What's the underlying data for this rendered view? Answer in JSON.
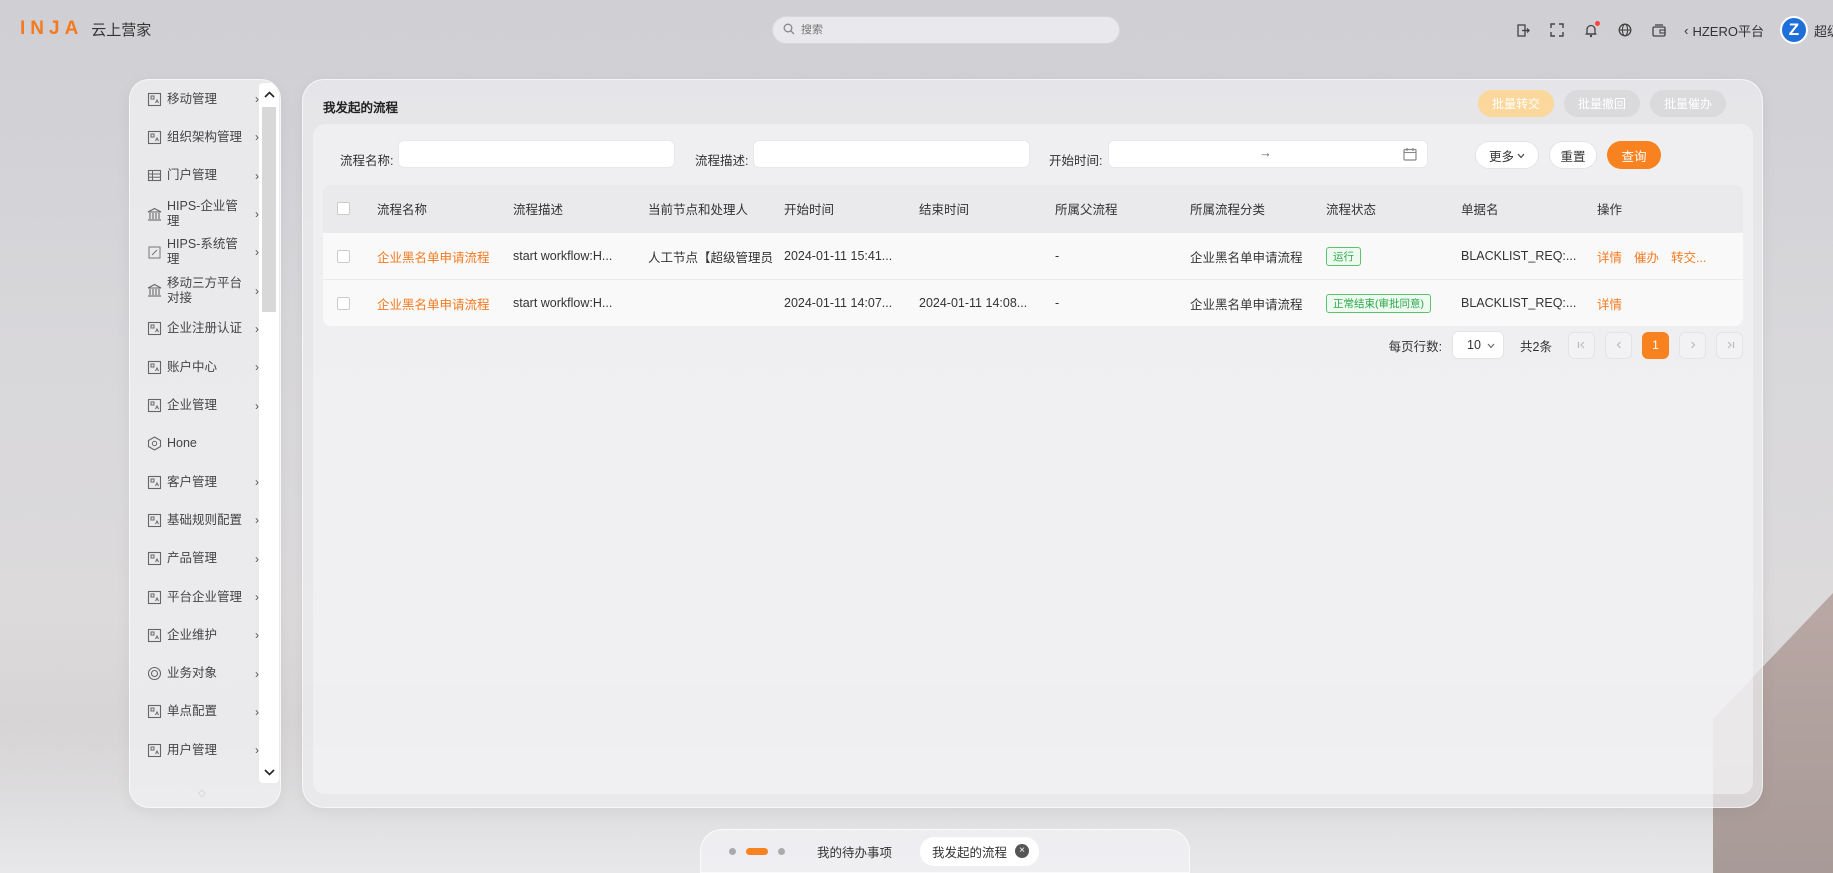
{
  "header": {
    "logo_mark": "INJA",
    "logo_text": "云上营家",
    "search_placeholder": "搜索",
    "platform": "HZERO平台",
    "user_name": "超级管",
    "avatar_letter": "Z",
    "icons": [
      "exit-icon",
      "fullscreen-icon",
      "bell-icon",
      "globe-icon",
      "wallet-icon"
    ]
  },
  "sidebar": {
    "items": [
      {
        "label": "移动管理",
        "icon": "module-icon",
        "arrow": true
      },
      {
        "label": "组织架构管理",
        "icon": "module-icon",
        "arrow": true
      },
      {
        "label": "门户管理",
        "icon": "table-icon",
        "arrow": true
      },
      {
        "label": "HIPS-企业管理",
        "icon": "bank-icon",
        "arrow": true
      },
      {
        "label": "HIPS-系统管理",
        "icon": "edit-icon",
        "arrow": true
      },
      {
        "label": "移动三方平台对接",
        "icon": "bank-icon",
        "arrow": true
      },
      {
        "label": "企业注册认证",
        "icon": "module-icon",
        "arrow": true
      },
      {
        "label": "账户中心",
        "icon": "module-icon",
        "arrow": true
      },
      {
        "label": "企业管理",
        "icon": "module-icon",
        "arrow": true
      },
      {
        "label": "Hone",
        "icon": "hexagon-icon",
        "arrow": false
      },
      {
        "label": "客户管理",
        "icon": "module-icon",
        "arrow": true
      },
      {
        "label": "基础规则配置",
        "icon": "module-icon",
        "arrow": true
      },
      {
        "label": "产品管理",
        "icon": "module-icon",
        "arrow": true
      },
      {
        "label": "平台企业管理",
        "icon": "module-icon",
        "arrow": true
      },
      {
        "label": "企业维护",
        "icon": "module-icon",
        "arrow": true
      },
      {
        "label": "业务对象",
        "icon": "target-icon",
        "arrow": true
      },
      {
        "label": "单点配置",
        "icon": "module-icon",
        "arrow": true
      },
      {
        "label": "用户管理",
        "icon": "module-icon",
        "arrow": true
      }
    ]
  },
  "main": {
    "title": "我发起的流程",
    "batch": {
      "transfer": "批量转交",
      "withdraw": "批量撤回",
      "urge": "批量催办"
    },
    "filters": {
      "name_label": "流程名称:",
      "desc_label": "流程描述:",
      "time_label": "开始时间:",
      "date_separator": "→",
      "more": "更多",
      "reset": "重置",
      "query": "查询"
    },
    "columns": [
      "流程名称",
      "流程描述",
      "当前节点和处理人",
      "开始时间",
      "结束时间",
      "所属父流程",
      "所属流程分类",
      "流程状态",
      "单据名",
      "操作"
    ],
    "rows": [
      {
        "name": "企业黑名单申请流程",
        "desc": "start workflow:H...",
        "node": "人工节点【超级管理员",
        "start": "2024-01-11 15:41...",
        "end": "",
        "parent": "-",
        "category": "企业黑名单申请流程",
        "status": "运行",
        "bill": "BLACKLIST_REQ:...",
        "ops": [
          "详情",
          "催办",
          "转交..."
        ]
      },
      {
        "name": "企业黑名单申请流程",
        "desc": "start workflow:H...",
        "node": "",
        "start": "2024-01-11 14:07...",
        "end": "2024-01-11 14:08...",
        "parent": "-",
        "category": "企业黑名单申请流程",
        "status": "正常结束(审批同意)",
        "bill": "BLACKLIST_REQ:...",
        "ops": [
          "详情"
        ]
      }
    ],
    "pagination": {
      "page_size_label": "每页行数:",
      "page_size": "10",
      "total": "共2条",
      "current_page": "1"
    }
  },
  "dock": {
    "tabs": [
      {
        "label": "我的待办事项",
        "active": false
      },
      {
        "label": "我发起的流程",
        "active": true
      }
    ]
  },
  "colors": {
    "accent": "#f7821f",
    "status_green": "#2aa84a"
  }
}
